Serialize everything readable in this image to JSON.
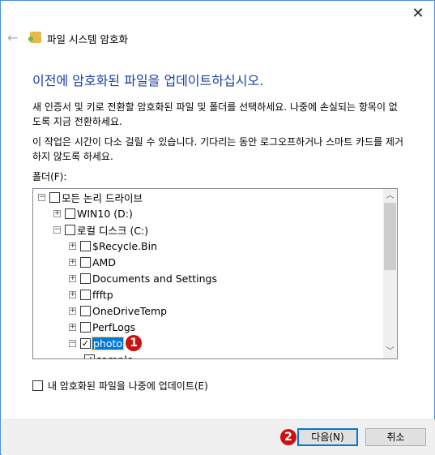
{
  "window": {
    "title": "파일 시스템 암호화",
    "close_icon": "close-icon",
    "back_icon": "back-arrow-icon"
  },
  "heading": "이전에 암호화된 파일을 업데이트하십시오.",
  "paragraph1": "새 인증서 및 키로 전환할 암호화된 파일 및 폴더를 선택하세요. 나중에 손실되는 항목이 없도록 지금 전환하세요.",
  "paragraph2": "이 작업은 시간이 다소 걸릴 수 있습니다. 기다리는 동안 로그오프하거나 스마트 카드를 제거하지 않도록 하세요.",
  "folder_label": "폴더(F):",
  "tree": [
    {
      "label": "모든 논리 드라이브",
      "level": 0,
      "expander": "minus",
      "checked": false
    },
    {
      "label": "WIN10 (D:)",
      "level": 1,
      "expander": "plus",
      "checked": false
    },
    {
      "label": "로컬 디스크 (C:)",
      "level": 1,
      "expander": "minus",
      "checked": false
    },
    {
      "label": "$Recycle.Bin",
      "level": 2,
      "expander": "plus",
      "checked": false
    },
    {
      "label": "AMD",
      "level": 2,
      "expander": "plus",
      "checked": false
    },
    {
      "label": "Documents and Settings",
      "level": 2,
      "expander": "plus",
      "checked": false
    },
    {
      "label": "ffftp",
      "level": 2,
      "expander": "plus",
      "checked": false
    },
    {
      "label": "OneDriveTemp",
      "level": 2,
      "expander": "plus",
      "checked": false
    },
    {
      "label": "PerfLogs",
      "level": 2,
      "expander": "plus",
      "checked": false
    },
    {
      "label": "photo",
      "level": 2,
      "expander": "minus",
      "checked": true,
      "selected": true
    },
    {
      "label": "sample",
      "level": 3,
      "expander": "none",
      "checked": true
    }
  ],
  "badges": {
    "one": "1",
    "two": "2"
  },
  "update_later_label": "내 암호화된 파일을 나중에 업데이트(E)",
  "buttons": {
    "next": "다음(N)",
    "cancel": "취소"
  },
  "colors": {
    "heading": "#1a3fa8",
    "selection": "#0078d7",
    "badge": "#cc1111"
  }
}
